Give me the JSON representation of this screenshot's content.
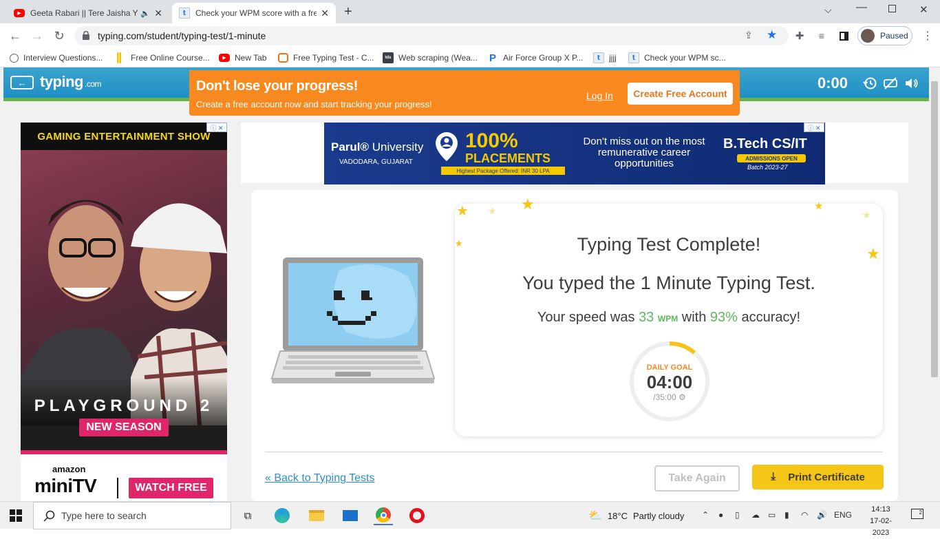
{
  "browser": {
    "tabs": [
      {
        "title": "Geeta Rabari || Tere Jaisha Ya",
        "icon": "youtube-icon",
        "muted_icon": "speaker-muted-icon"
      },
      {
        "title": "Check your WPM score with a fre",
        "icon": "typing-t-icon",
        "active": true
      }
    ],
    "url": "typing.com/student/typing-test/1-minute",
    "profile_status": "Paused",
    "bookmarks": [
      {
        "label": "Interview Questions...",
        "icon": "globe-icon"
      },
      {
        "label": "Free Online Course...",
        "icon": "free-course-icon"
      },
      {
        "label": "New Tab",
        "icon": "youtube-icon"
      },
      {
        "label": "Free Typing Test - C...",
        "icon": "chat-bubble-icon"
      },
      {
        "label": "Web scraping (Wea...",
        "icon": "tds-icon"
      },
      {
        "label": "Air Force Group X P...",
        "icon": "p-icon"
      },
      {
        "label": "jjjj",
        "icon": "typing-t-icon"
      },
      {
        "label": "Check your WPM sc...",
        "icon": "typing-t-icon"
      }
    ]
  },
  "site": {
    "logo": "typing",
    "logo_suffix": ".com",
    "timer": "0:00",
    "promo": {
      "title": "Don't lose your progress!",
      "subtitle": "Create a free account now and start tracking your progress!",
      "login": "Log In",
      "create": "Create Free Account"
    }
  },
  "side_ad": {
    "title": "GAMING ENTERTAINMENT SHOW",
    "show": "PLAYGROUND 2",
    "season": "NEW SEASON",
    "brand_top": "amazon",
    "brand": "miniTV",
    "cta": "WATCH FREE"
  },
  "top_ad": {
    "university": "Parul",
    "university_suffix": "University",
    "location": "VADODARA, GUJARAT",
    "percent": "100%",
    "placements": "PLACEMENTS",
    "package": "Highest Package Offered: INR 30 LPA",
    "tagline": "Don't miss out on the most remunerative career opportunities",
    "course": "B.Tech CS/IT",
    "admissions": "ADMISSIONS OPEN",
    "batch": "Batch 2023-27"
  },
  "result": {
    "title": "Typing Test Complete!",
    "line_prefix": "You typed the",
    "test_name": "1 Minute Typing Test.",
    "speed_prefix": "Your speed was",
    "wpm_value": "33",
    "wpm_unit": "WPM",
    "speed_mid": "with",
    "accuracy": "93%",
    "speed_suffix": "accuracy!",
    "goal_label": "DAILY GOAL",
    "goal_value": "04:00",
    "goal_total": "/35:00",
    "goal_progress": 0.114,
    "back_link": "« Back to Typing Tests",
    "take_again": "Take Again",
    "print": "Print Certificate"
  },
  "taskbar": {
    "search_placeholder": "Type here to search",
    "temperature": "18°C",
    "weather": "Partly cloudy",
    "language": "ENG",
    "time": "14:13",
    "date": "17-02-2023",
    "notification_count": "2"
  },
  "colors": {
    "brand_blue": "#1f8fc4",
    "promo_orange": "#f7891f",
    "green": "#5cb85c",
    "yellow": "#f5c518"
  }
}
